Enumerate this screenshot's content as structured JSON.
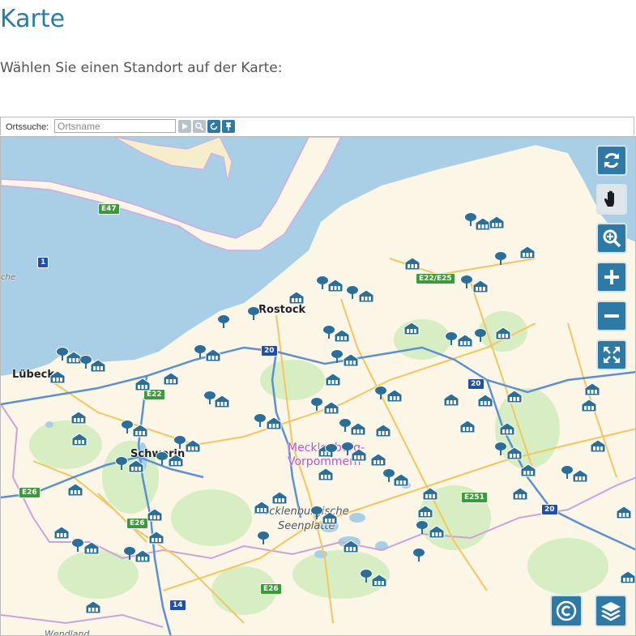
{
  "page": {
    "title": "Karte",
    "intro": "Wählen Sie einen Standort auf der Karte:"
  },
  "search": {
    "label": "Ortssuche:",
    "placeholder": "Ortsname"
  },
  "map": {
    "place_labels": [
      {
        "text": "Rostock"
      },
      {
        "text": "Lübeck"
      },
      {
        "text": "Schwerin"
      },
      {
        "text": "Mecklenburg-"
      },
      {
        "text": "Vorpommern"
      },
      {
        "text": "Mecklenburgische"
      },
      {
        "text": "Seenplatte"
      },
      {
        "text": "Wendland"
      },
      {
        "text": "che"
      }
    ],
    "road_shields": [
      "E47",
      "1",
      "E22/E25",
      "20",
      "E22",
      "20",
      "E26",
      "E26",
      "E251",
      "20",
      "E26",
      "14"
    ],
    "colors": {
      "water": "#a8cfe6",
      "land": "#fbf6e6",
      "forest": "#d6eec2",
      "road_major": "#5b8fd6",
      "road_minor": "#f4c65c",
      "marker": "#2a6f99",
      "control": "#2e7aa6"
    }
  },
  "controls": {
    "refresh": "refresh-icon",
    "pan": "hand-icon",
    "zoom_box": "zoom-magnifier-icon",
    "zoom_in": "plus-icon",
    "zoom_out": "minus-icon",
    "fullscreen": "fullscreen-icon",
    "copyright": "copyright-icon",
    "layers": "layers-icon"
  }
}
